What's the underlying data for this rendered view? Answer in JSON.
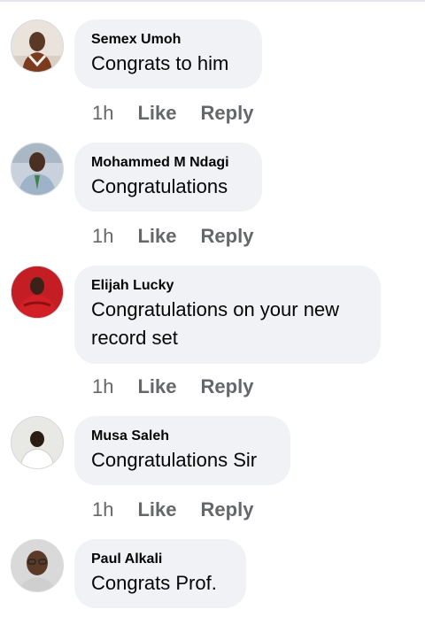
{
  "comments": [
    {
      "author": "Semex Umoh",
      "text": "Congrats to him",
      "time": "1h",
      "like_label": "Like",
      "reply_label": "Reply",
      "avatar_colors": {
        "bg": "#e9e3dc",
        "skin": "#5a3a26",
        "cloth": "#7a3b1f"
      }
    },
    {
      "author": "Mohammed M Ndagi",
      "text": "Congratulations",
      "time": "1h",
      "like_label": "Like",
      "reply_label": "Reply",
      "avatar_colors": {
        "bg": "#c9d2dc",
        "skin": "#4b3022",
        "cloth": "#9fb3c8"
      }
    },
    {
      "author": "Elijah Lucky",
      "text": "Congratulations on your new record set",
      "text_line1": "Congratulations on your new",
      "text_line2": "record set",
      "time": "1h",
      "like_label": "Like",
      "reply_label": "Reply",
      "avatar_colors": {
        "bg": "#b3151a",
        "skin": "#3a2218",
        "cloth": "#d32027"
      }
    },
    {
      "author": "Musa Saleh",
      "text": "Congratulations Sir",
      "time": "1h",
      "like_label": "Like",
      "reply_label": "Reply",
      "avatar_colors": {
        "bg": "#e8e8e4",
        "skin": "#2b1c14",
        "cloth": "#ffffff"
      }
    },
    {
      "author": "Paul Alkali",
      "text": "Congrats Prof.",
      "time": "",
      "like_label": "",
      "reply_label": "",
      "avatar_colors": {
        "bg": "#d9d9d9",
        "skin": "#5b3a28",
        "cloth": "#cfcfcf"
      }
    }
  ]
}
